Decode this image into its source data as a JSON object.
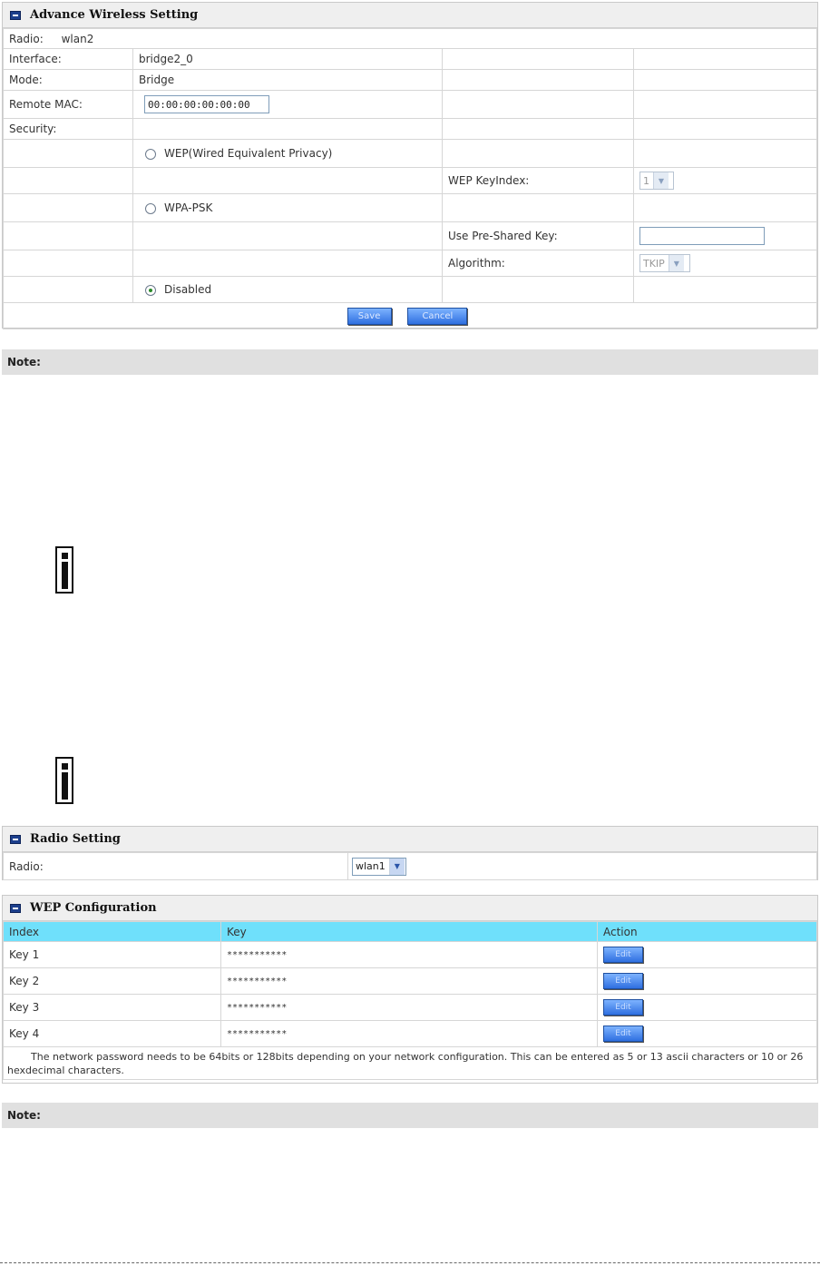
{
  "advance": {
    "title": "Advance Wireless Setting",
    "radio_label": "Radio:",
    "radio_value": "wlan2",
    "interface_label": "Interface:",
    "interface_value": "bridge2_0",
    "mode_label": "Mode:",
    "mode_value": "Bridge",
    "remote_mac_label": "Remote MAC:",
    "remote_mac_value": "00:00:00:00:00:00",
    "security_label": "Security:",
    "wep_option": "WEP(Wired Equivalent Privacy)",
    "wep_keyindex_label": "WEP KeyIndex:",
    "wep_keyindex_value": "1",
    "wpa_option": "WPA-PSK",
    "psk_label": "Use Pre-Shared Key:",
    "psk_value": "",
    "algorithm_label": "Algorithm:",
    "algorithm_value": "TKIP",
    "disabled_option": "Disabled",
    "selected_security": "Disabled",
    "save_label": "Save",
    "cancel_label": "Cancel"
  },
  "note1": {
    "label": "Note:"
  },
  "radio_setting": {
    "title": "Radio Setting",
    "radio_label": "Radio:",
    "radio_value": "wlan1"
  },
  "wep_config": {
    "title": "WEP Configuration",
    "columns": [
      "Index",
      "Key",
      "Action"
    ],
    "rows": [
      {
        "index": "Key 1",
        "key": "***********",
        "action": "Edit"
      },
      {
        "index": "Key 2",
        "key": "***********",
        "action": "Edit"
      },
      {
        "index": "Key 3",
        "key": "***********",
        "action": "Edit"
      },
      {
        "index": "Key 4",
        "key": "***********",
        "action": "Edit"
      }
    ],
    "footnote": "The network password needs to be 64bits or 128bits depending on your network configuration. This can be entered as 5 or 13 ascii characters or 10 or 26 hexdecimal characters."
  },
  "note2": {
    "label": "Note:"
  },
  "icons": [
    "section-icon",
    "info-icon",
    "radio-icon",
    "dropdown-arrow-icon"
  ],
  "colors": {
    "header_row": "#6fe0fb",
    "button": "#2f6fe0",
    "note_bar": "#e0e0e0",
    "section_icon": "#1c3f8c"
  }
}
